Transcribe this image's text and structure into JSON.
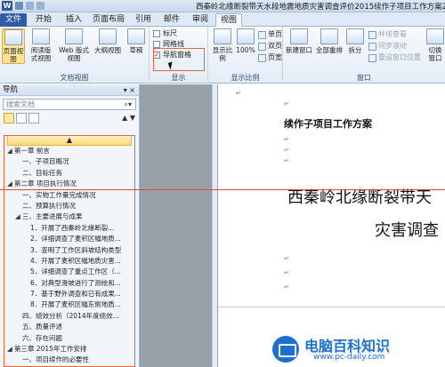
{
  "titlebar": {
    "app_icon": "W",
    "document_title": "西秦岭北缘断裂带天水段地震地质灾害调查评价2015续作子项目工作方案20150520.doc"
  },
  "tabs": [
    "文件",
    "开始",
    "插入",
    "页面布局",
    "引用",
    "邮件",
    "审阅",
    "视图"
  ],
  "ribbon": {
    "doc_views": {
      "label": "文档视图",
      "buttons": [
        "页面视图",
        "阅读版式视图",
        "Web 版式视图",
        "大纲视图",
        "草稿"
      ]
    },
    "show": {
      "label": "显示",
      "items": [
        {
          "label": "标尺",
          "checked": false
        },
        {
          "label": "网格线",
          "checked": false
        },
        {
          "label": "导航窗格",
          "checked": true
        }
      ]
    },
    "zoom": {
      "label": "显示比例",
      "buttons": [
        "显示比例",
        "100%"
      ],
      "small": [
        "单页",
        "双页",
        "页宽"
      ]
    },
    "window": {
      "label": "窗口",
      "buttons": [
        "新建窗口",
        "全部重排",
        "拆分"
      ],
      "small": [
        "并排查看",
        "同步滚动",
        "重设窗口位置"
      ],
      "switch": "切换窗口"
    }
  },
  "nav": {
    "title": "导航",
    "search_placeholder": "搜索文档",
    "tree": [
      {
        "text": "第一章 前言",
        "level": 0,
        "toggle": "◢"
      },
      {
        "text": "一、子项目概况",
        "level": 1
      },
      {
        "text": "二、目标任务",
        "level": 1
      },
      {
        "text": "第二章 项目执行情况",
        "level": 0,
        "toggle": "◢"
      },
      {
        "text": "一、实物工作量完成情况",
        "level": 1
      },
      {
        "text": "二、预算执行情况",
        "level": 1
      },
      {
        "text": "三、主要进展与成果",
        "level": 1,
        "toggle": "◢"
      },
      {
        "text": "1．开展了西秦岭北缘断裂...",
        "level": 2
      },
      {
        "text": "2．详细调查了麦积区幅地质...",
        "level": 2
      },
      {
        "text": "3．查明了工作区斜坡结构类型",
        "level": 2
      },
      {
        "text": "4．开展了麦积区幅地质灾害...",
        "level": 2
      },
      {
        "text": "5．详细调查了重点工作区（...",
        "level": 2
      },
      {
        "text": "6．对典型滑坡进行了测绘和...",
        "level": 2
      },
      {
        "text": "7．基于野外调查和已有成果...",
        "level": 2
      },
      {
        "text": "8．开展了麦积区幅东侧地质...",
        "level": 2
      },
      {
        "text": "四、绩效分析（2014年度绩效...",
        "level": 1
      },
      {
        "text": "五、质量评述",
        "level": 1
      },
      {
        "text": "六、存在问题",
        "level": 1
      },
      {
        "text": "第三章 2015年工作安排",
        "level": 0,
        "toggle": "◢"
      },
      {
        "text": "一、项目续作的必要性",
        "level": 1
      }
    ]
  },
  "document": {
    "heading_small": "续作子项目工作方案",
    "heading_line1": "西秦岭北缘断裂带天",
    "heading_line2": "灾害调查"
  },
  "watermark": {
    "title": "电脑百科知识",
    "url": "www.pc-daily.com"
  }
}
